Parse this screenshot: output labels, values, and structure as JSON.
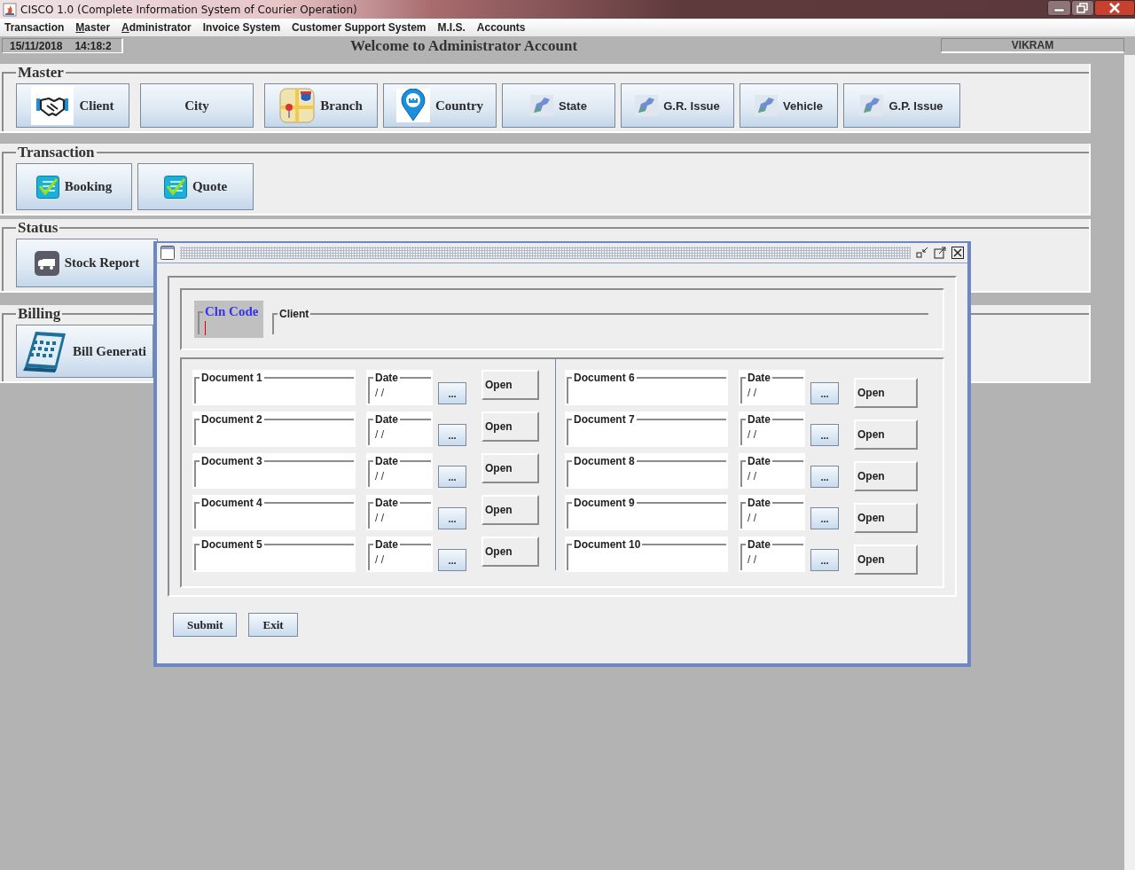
{
  "window": {
    "title": "CISCO 1.0 (Complete Information System of Courier Operation)"
  },
  "menu": [
    {
      "label": "Transaction",
      "mnemonic": false
    },
    {
      "label": "Master",
      "mnemonic": true
    },
    {
      "label": "Administrator",
      "mnemonic": true
    },
    {
      "label": "Invoice System",
      "mnemonic": false
    },
    {
      "label": "Customer Support System",
      "mnemonic": false
    },
    {
      "label": "M.I.S.",
      "mnemonic": false
    },
    {
      "label": "Accounts",
      "mnemonic": false
    }
  ],
  "status_bar": {
    "date": "15/11/2018",
    "time": "14:18:2",
    "welcome": "Welcome to Administrator Account",
    "user": "VIKRAM"
  },
  "groups": [
    {
      "title": "Master",
      "buttons": [
        {
          "label": "Client",
          "kind": "handshake"
        },
        {
          "label": "City",
          "kind": "plain"
        },
        {
          "label": "Branch",
          "kind": "map"
        },
        {
          "label": "Country",
          "kind": "pin"
        },
        {
          "label": "State",
          "kind": "region"
        },
        {
          "label": "G.R. Issue",
          "kind": "region"
        },
        {
          "label": "Vehicle",
          "kind": "region"
        },
        {
          "label": "G.P. Issue",
          "kind": "region"
        }
      ]
    },
    {
      "title": "Transaction",
      "buttons": [
        {
          "label": "Booking",
          "kind": "checklist"
        },
        {
          "label": "Quote",
          "kind": "checklist"
        }
      ]
    },
    {
      "title": "Status",
      "buttons": [
        {
          "label": "Stock Report",
          "kind": "truck"
        }
      ]
    },
    {
      "title": "Billing",
      "buttons": [
        {
          "label": "Bill Generati",
          "kind": "calendar"
        }
      ]
    }
  ],
  "dialog": {
    "cln_code": {
      "label": "Cln Code",
      "focused": true
    },
    "client": {
      "label": "Client"
    },
    "documents": [
      {
        "label": "Document 1",
        "date_label": "Date",
        "date": "/ /",
        "picker": "...",
        "open": "Open"
      },
      {
        "label": "Document 2",
        "date_label": "Date",
        "date": "/ /",
        "picker": "...",
        "open": "Open"
      },
      {
        "label": "Document 3",
        "date_label": "Date",
        "date": "/ /",
        "picker": "...",
        "open": "Open"
      },
      {
        "label": "Document 4",
        "date_label": "Date",
        "date": "/ /",
        "picker": "...",
        "open": "Open"
      },
      {
        "label": "Document 5",
        "date_label": "Date",
        "date": "/ /",
        "picker": "...",
        "open": "Open"
      },
      {
        "label": "Document 6",
        "date_label": "Date",
        "date": "/ /",
        "picker": "...",
        "open": "Open"
      },
      {
        "label": "Document 7",
        "date_label": "Date",
        "date": "/ /",
        "picker": "...",
        "open": "Open"
      },
      {
        "label": "Document 8",
        "date_label": "Date",
        "date": "/ /",
        "picker": "...",
        "open": "Open"
      },
      {
        "label": "Document 9",
        "date_label": "Date",
        "date": "/ /",
        "picker": "...",
        "open": "Open"
      },
      {
        "label": "Document 10",
        "date_label": "Date",
        "date": "/ /",
        "picker": "...",
        "open": "Open"
      }
    ],
    "buttons": [
      "Submit",
      "Exit"
    ]
  }
}
